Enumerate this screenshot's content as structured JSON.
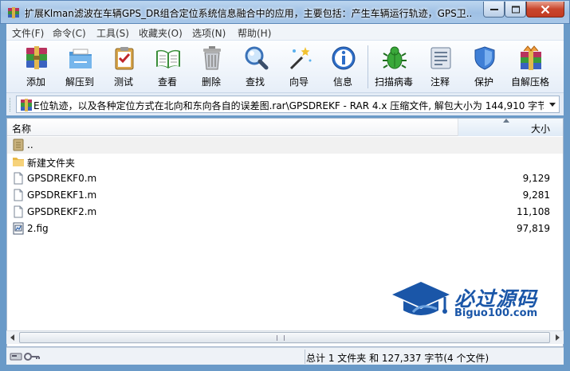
{
  "window": {
    "title": "扩展Klman滤波在车辆GPS_DR组合定位系统信息融合中的应用，主要包括：产生车辆运行轨迹，GPS卫..."
  },
  "menu": [
    "文件(F)",
    "命令(C)",
    "工具(S)",
    "收藏夹(O)",
    "选项(N)",
    "帮助(H)"
  ],
  "toolbar": {
    "buttons": [
      {
        "label": "添加",
        "icon": "add-archive-icon"
      },
      {
        "label": "解压到",
        "icon": "extract-to-folder-icon"
      },
      {
        "label": "测试",
        "icon": "test-clipboard-icon"
      },
      {
        "label": "查看",
        "icon": "view-book-icon"
      },
      {
        "label": "删除",
        "icon": "delete-trash-icon"
      },
      {
        "label": "查找",
        "icon": "find-magnifier-icon"
      },
      {
        "label": "向导",
        "icon": "wizard-wand-icon"
      },
      {
        "label": "信息",
        "icon": "info-icon"
      },
      {
        "label": "扫描病毒",
        "icon": "scan-virus-icon"
      },
      {
        "label": "注释",
        "icon": "comment-icon"
      },
      {
        "label": "保护",
        "icon": "protect-shield-icon"
      },
      {
        "label": "自解压格",
        "icon": "sfx-archive-icon"
      }
    ]
  },
  "address": {
    "path": "E位轨迹，以及各种定位方式在北向和东向各自的误差图.rar\\GPSDREKF - RAR 4.x 压缩文件, 解包大小为 144,910 字节"
  },
  "list": {
    "columns": {
      "name": "名称",
      "size": "大小"
    },
    "rows": [
      {
        "name": "..",
        "size": "",
        "type": "parent"
      },
      {
        "name": "新建文件夹",
        "size": "",
        "type": "folder"
      },
      {
        "name": "GPSDREKF0.m",
        "size": "9,129",
        "type": "file"
      },
      {
        "name": "GPSDREKF1.m",
        "size": "9,281",
        "type": "file"
      },
      {
        "name": "GPSDREKF2.m",
        "size": "11,108",
        "type": "file"
      },
      {
        "name": "2.fig",
        "size": "97,819",
        "type": "fig"
      }
    ]
  },
  "watermark": {
    "name": "必过源码",
    "site": "Biguo100.com"
  },
  "status": {
    "summary": "总计 1 文件夹 和 127,337 字节(4 个文件)"
  },
  "colors": {
    "accent": "#1a56a8",
    "titlebar": "#a8c7e8",
    "close": "#c9452c"
  }
}
